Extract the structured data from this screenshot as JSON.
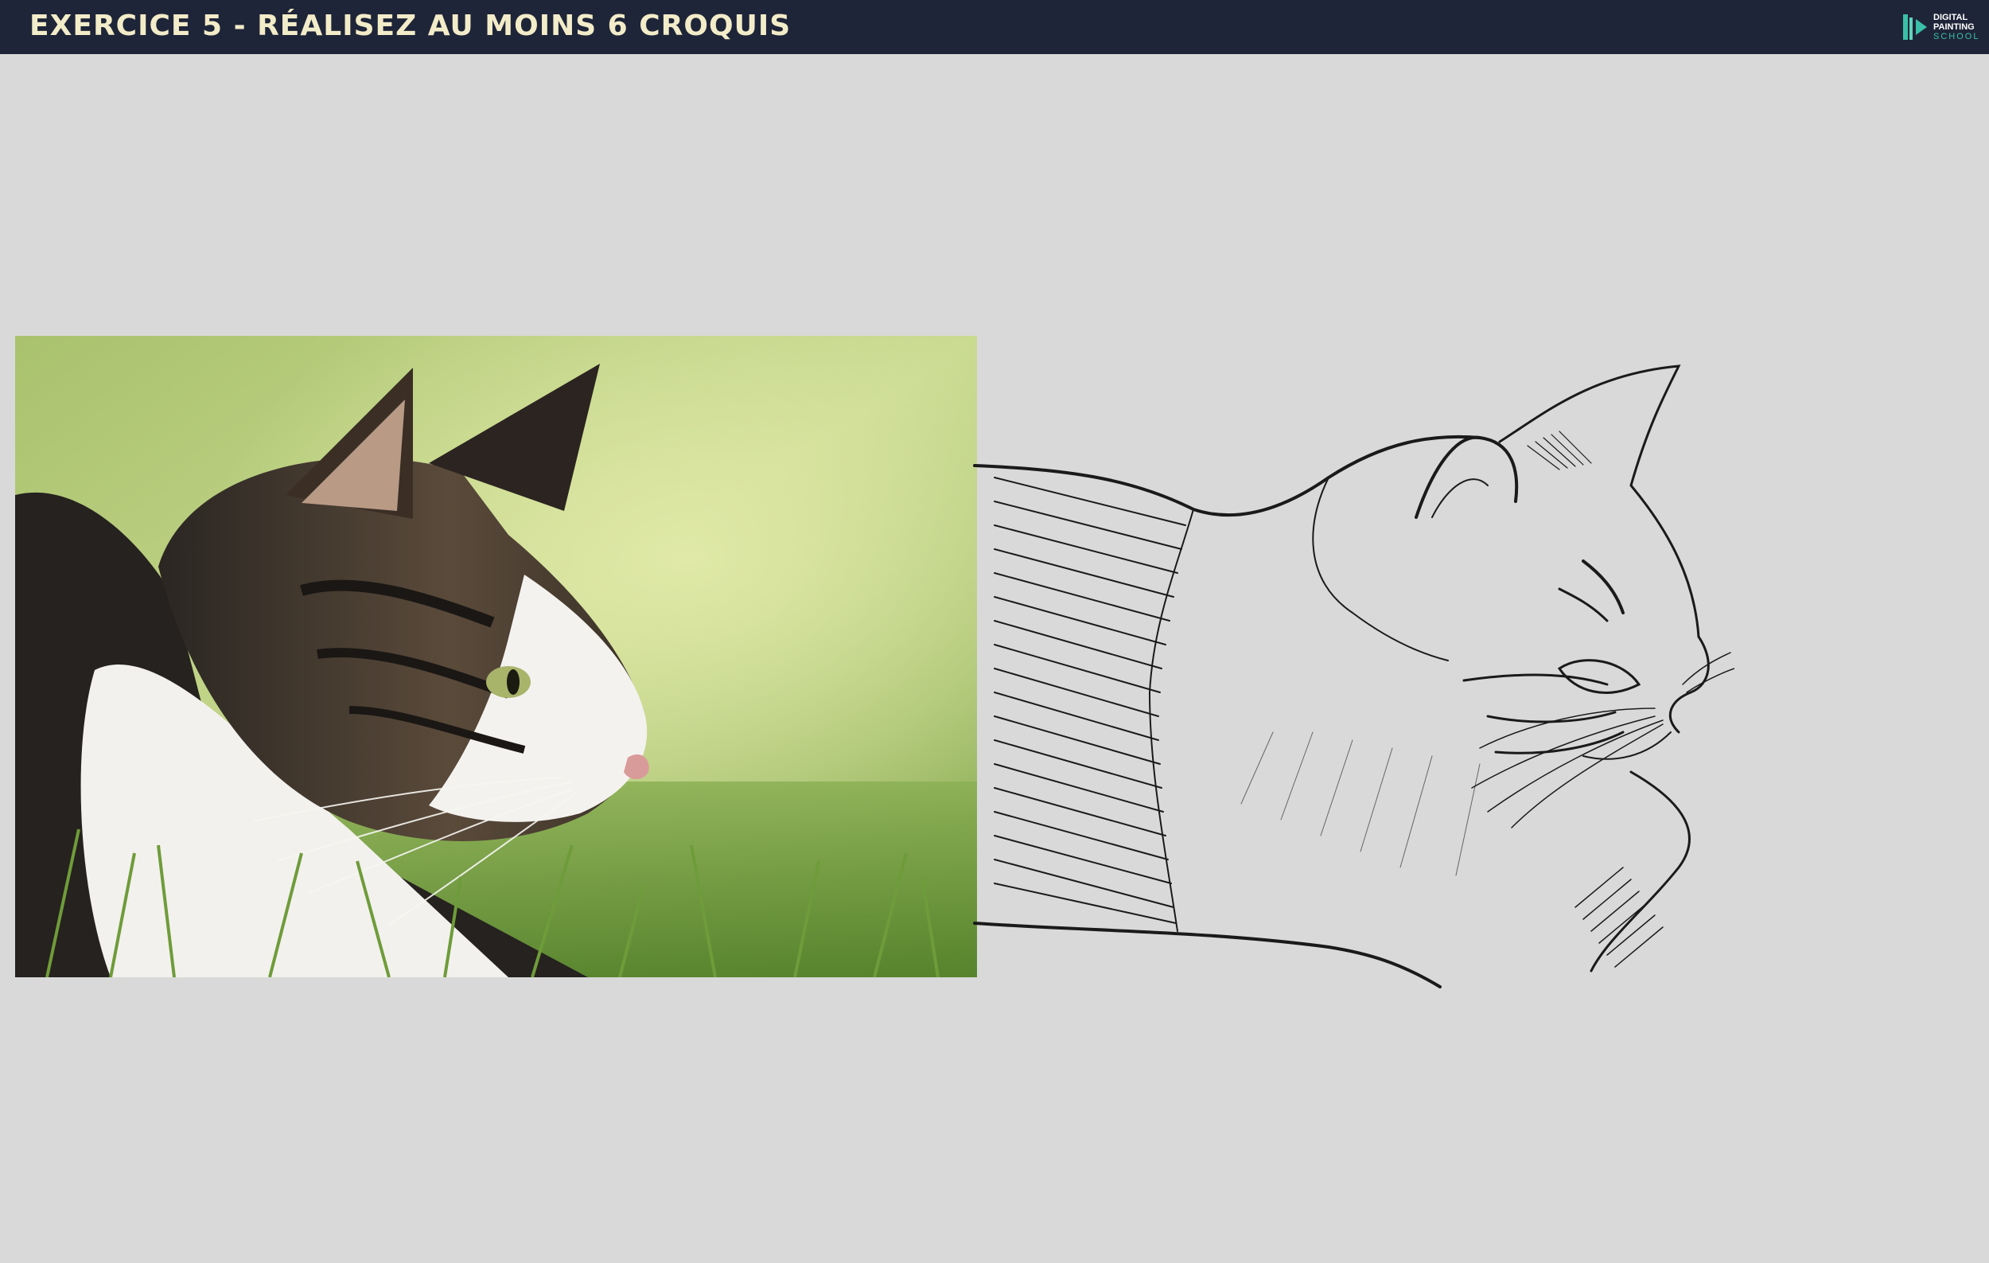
{
  "header": {
    "title": "EXERCICE 5 - RÉALISEZ AU MOINS 6 CROQUIS",
    "logo": {
      "line1": "DIGITAL",
      "line2": "PAINTING",
      "line3": "SCHOOL"
    }
  },
  "colors": {
    "topbar": "#1f2538",
    "title": "#f3ecc9",
    "logo_accent": "#3ac0a8",
    "background": "#d9d9d9"
  },
  "main": {
    "photo_icon": "cat-photo",
    "sketch_icon": "cat-line-sketch"
  }
}
